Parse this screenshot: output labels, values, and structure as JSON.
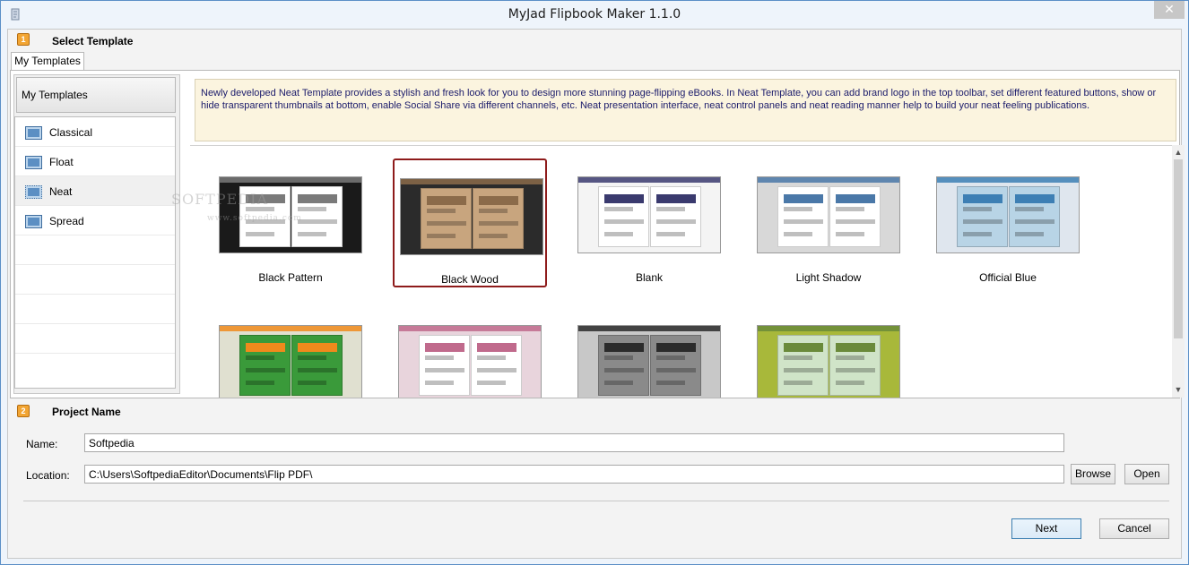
{
  "window": {
    "title": "MyJad Flipbook Maker 1.1.0",
    "close_glyph": "✕"
  },
  "section1": {
    "badge": "1",
    "title": "Select Template"
  },
  "tab": {
    "label": "My Templates"
  },
  "sidebar": {
    "header": "My Templates",
    "items": [
      {
        "label": "Classical",
        "icon": "template-icon"
      },
      {
        "label": "Float",
        "icon": "template-icon"
      },
      {
        "label": "Neat",
        "icon": "template-icon"
      },
      {
        "label": "Spread",
        "icon": "template-icon"
      }
    ]
  },
  "description": "Newly developed Neat Template provides a stylish and fresh look for you to design more stunning page-flipping eBooks. In Neat Template, you can add brand logo in the top toolbar, set different featured buttons, show or hide transparent thumbnails at bottom, enable Social Share via different channels, etc. Neat presentation interface, neat control panels and neat reading manner help to build your neat feeling publications.",
  "templates": [
    {
      "label": "Black Pattern",
      "colors": [
        "#1a1a1a",
        "#7a7a7a",
        "#ffffff"
      ]
    },
    {
      "label": "Black Wood",
      "colors": [
        "#2b2b2b",
        "#8b6b4a",
        "#c8a57e"
      ]
    },
    {
      "label": "Blank",
      "colors": [
        "#f4f4f4",
        "#3a3a6e",
        "#ffffff"
      ]
    },
    {
      "label": "Light Shadow",
      "colors": [
        "#d8d8d8",
        "#4a78a8",
        "#ffffff"
      ]
    },
    {
      "label": "Official Blue",
      "colors": [
        "#dfe6ee",
        "#3d7fb4",
        "#b8d4e6"
      ]
    },
    {
      "label": "",
      "colors": [
        "#e0e0d0",
        "#f08a1c",
        "#3a9a3a"
      ]
    },
    {
      "label": "",
      "colors": [
        "#e8d4dc",
        "#c06a8c",
        "#ffffff"
      ]
    },
    {
      "label": "",
      "colors": [
        "#c8c8c8",
        "#2b2b2b",
        "#8a8a8a"
      ]
    },
    {
      "label": "",
      "colors": [
        "#a8b83a",
        "#6a8a3a",
        "#d0e4c8"
      ]
    }
  ],
  "section2": {
    "badge": "2",
    "title": "Project Name",
    "name_label": "Name:",
    "name_value": "Softpedia",
    "location_label": "Location:",
    "location_value": "C:\\Users\\SoftpediaEditor\\Documents\\Flip PDF\\"
  },
  "buttons": {
    "browse": "Browse",
    "open": "Open",
    "next": "Next",
    "cancel": "Cancel"
  },
  "watermark": {
    "brand": "SOFTPEDIA",
    "url": "www.softpedia.com"
  }
}
